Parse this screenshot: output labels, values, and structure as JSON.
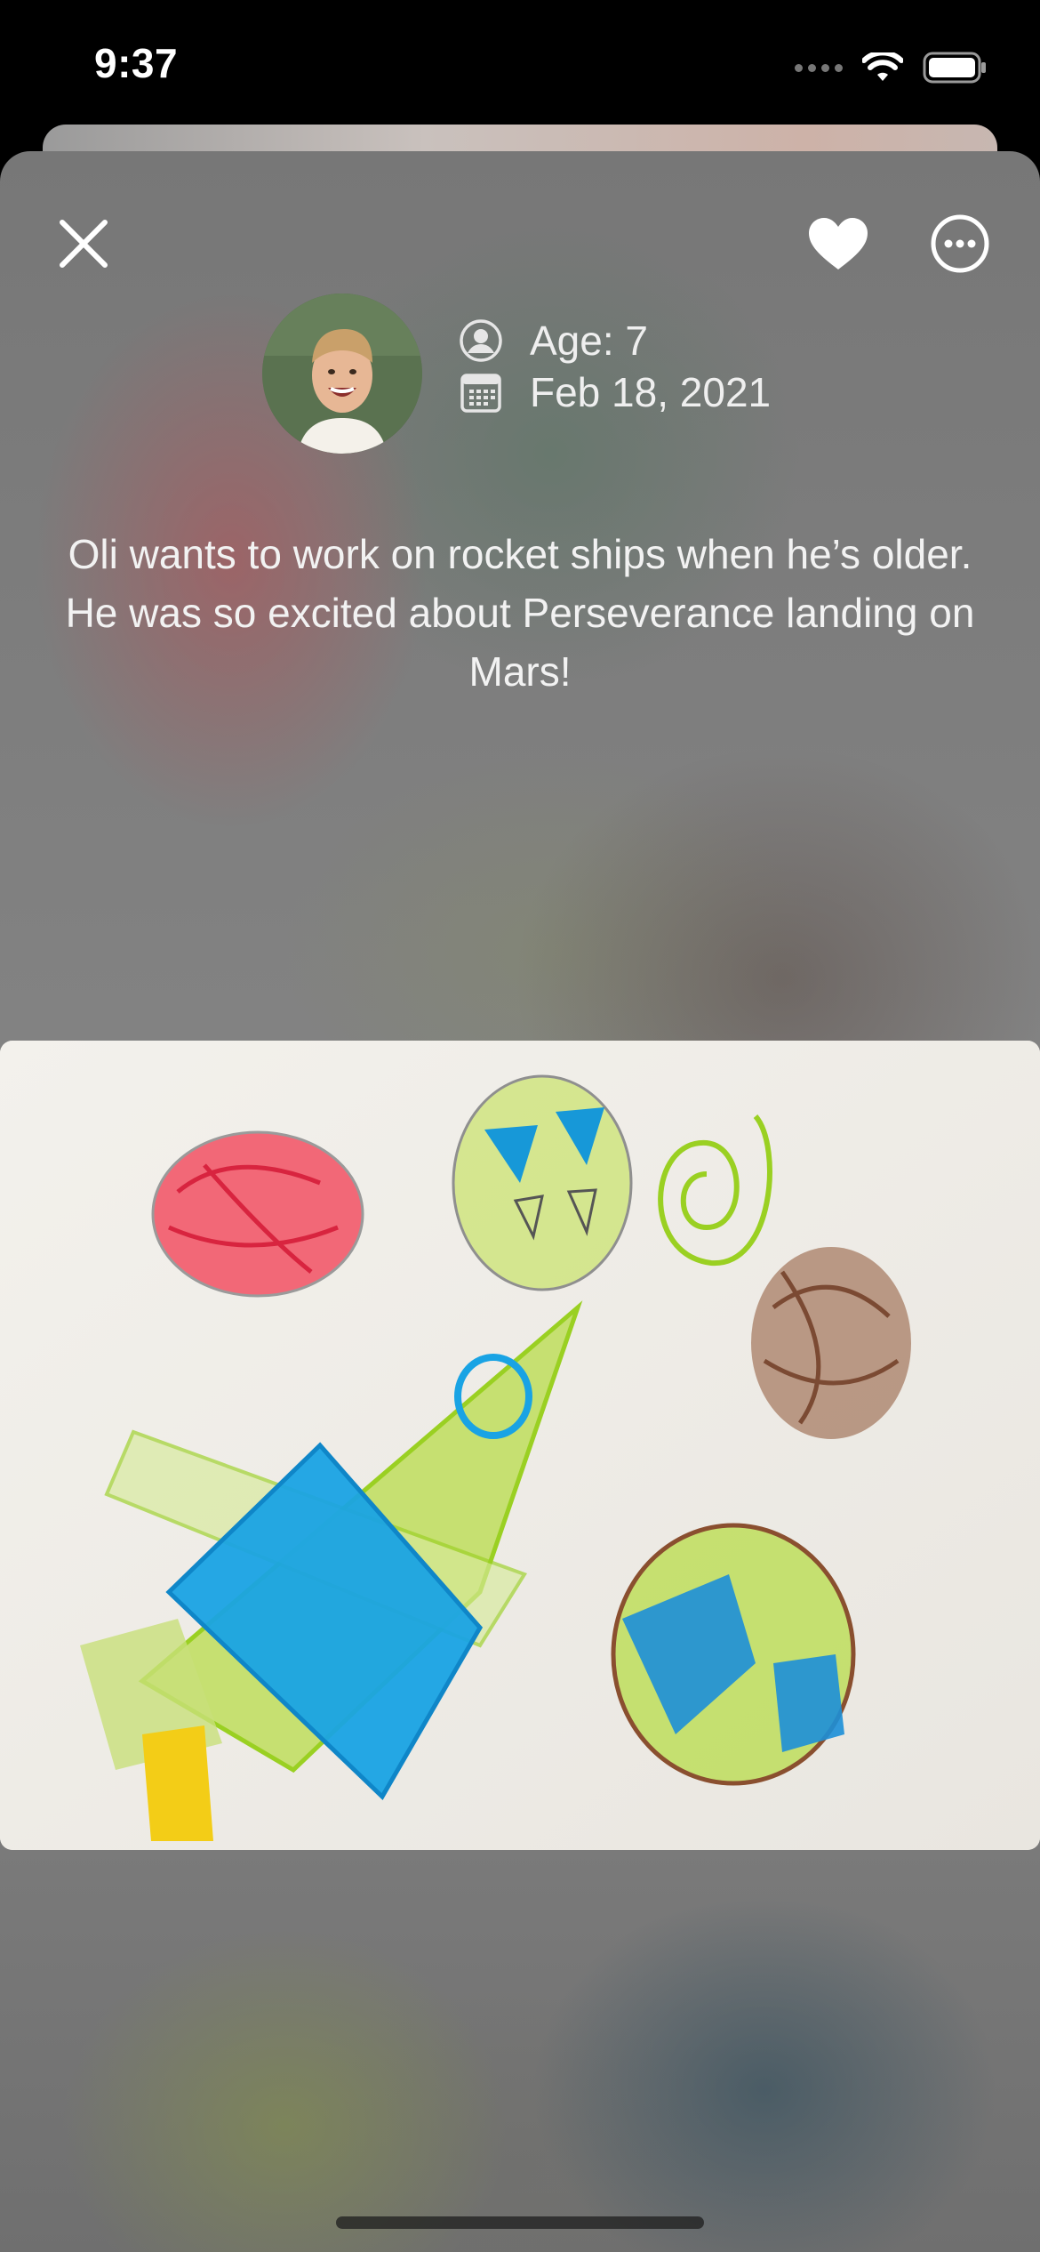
{
  "status_bar": {
    "time": "9:37"
  },
  "header": {
    "close_icon": "close-icon",
    "favorite_icon": "heart-icon",
    "more_icon": "ellipsis-circle-icon"
  },
  "profile": {
    "avatar_alt": "child-photo",
    "age_label": "Age: 7",
    "date_label": "Feb 18, 2021"
  },
  "memory": {
    "description": "Oli wants to work on rocket ships when he’s older. He was so excited about Perseverance landing on Mars!",
    "artwork": "crayon-drawing-rocket-and-planets"
  }
}
